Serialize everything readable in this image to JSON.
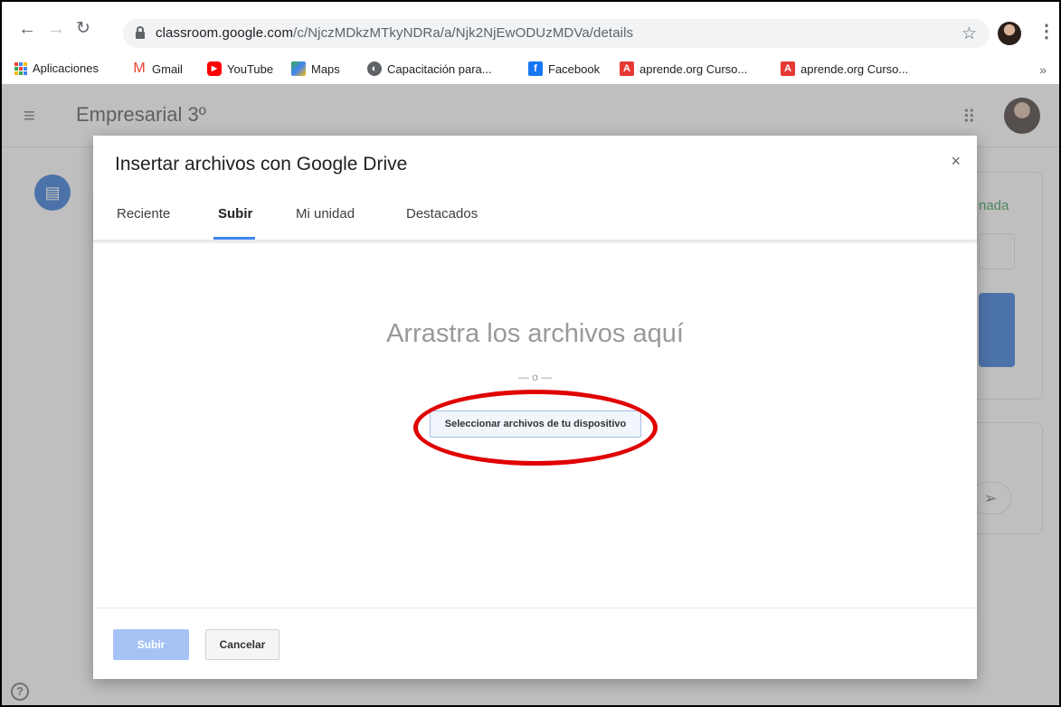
{
  "browser": {
    "url_host": "classroom.google.com",
    "url_path": "/c/NjczMDkzMTkyNDRa/a/Njk2NjEwODUzMDVa/details",
    "bookmarks": [
      {
        "label": "Aplicaciones",
        "icon": "apps-icon"
      },
      {
        "label": "Gmail",
        "icon": "gmail-icon"
      },
      {
        "label": "YouTube",
        "icon": "youtube-icon"
      },
      {
        "label": "Maps",
        "icon": "maps-icon"
      },
      {
        "label": "Capacitación para...",
        "icon": "globe-icon"
      },
      {
        "label": "Facebook",
        "icon": "facebook-icon"
      },
      {
        "label": "aprende.org Curso...",
        "icon": "aprende-icon"
      },
      {
        "label": "aprende.org Curso...",
        "icon": "aprende-icon"
      }
    ],
    "more_bookmarks": "»"
  },
  "classroom": {
    "class_name": "Empresarial 3º",
    "right_card_text": "nada"
  },
  "dialog": {
    "title": "Insertar archivos con Google Drive",
    "close": "×",
    "tabs": [
      {
        "label": "Reciente",
        "active": false
      },
      {
        "label": "Subir",
        "active": true
      },
      {
        "label": "Mi unidad",
        "active": false
      },
      {
        "label": "Destacados",
        "active": false
      }
    ],
    "drop_hint": "Arrastra los archivos aquí",
    "or_separator": "— o —",
    "select_button": "Seleccionar archivos de tu dispositivo",
    "upload_button": "Subir",
    "cancel_button": "Cancelar"
  },
  "colors": {
    "accent_blue": "#4285f4",
    "highlight_red": "#e00000",
    "disabled_blue": "#a6c3f5"
  }
}
